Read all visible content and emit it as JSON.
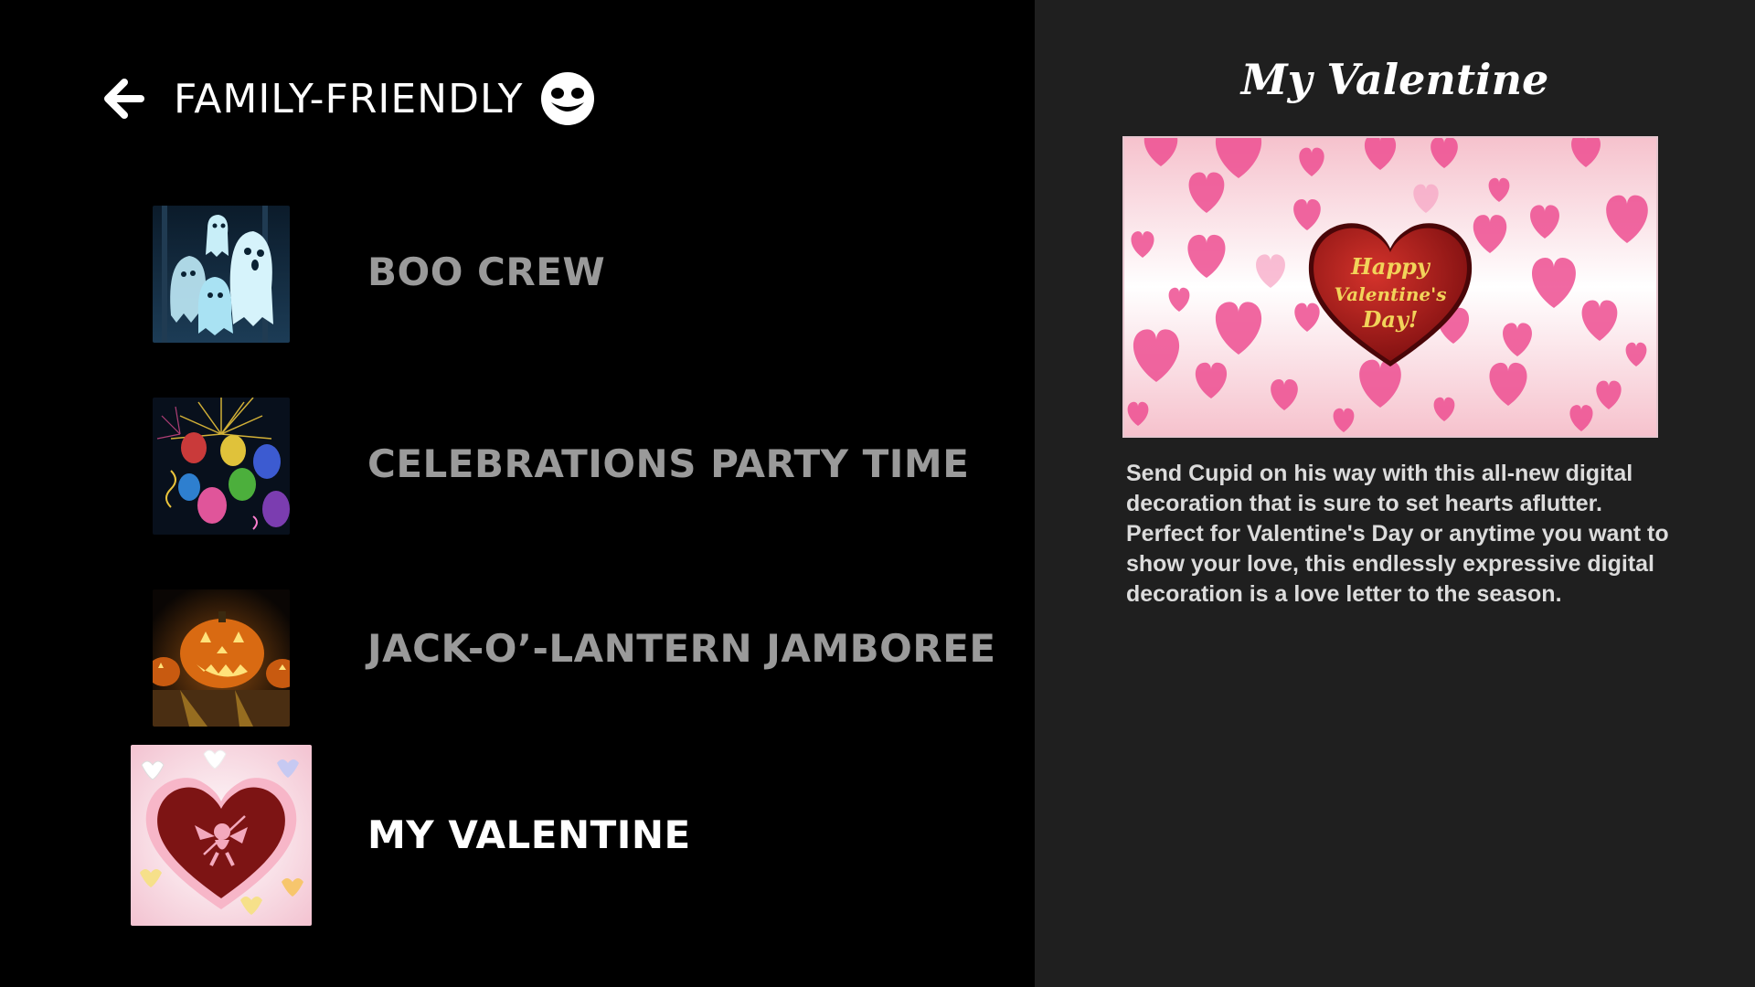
{
  "header": {
    "title": "FAMILY-FRIENDLY",
    "back_icon": "arrow-left-icon",
    "category_icon": "smiley-face-icon"
  },
  "list": {
    "items": [
      {
        "label": "BOO CREW",
        "thumbnail": "ghosts"
      },
      {
        "label": "CELEBRATIONS PARTY TIME",
        "thumbnail": "balloons-fireworks"
      },
      {
        "label": "JACK-O’-LANTERN JAMBOREE",
        "thumbnail": "jack-o-lanterns"
      },
      {
        "label": "MY VALENTINE",
        "thumbnail": "valentine-heart-cupid",
        "selected": true
      }
    ]
  },
  "detail": {
    "title": "My Valentine",
    "hero_text": [
      "Happy",
      "Valentine's",
      "Day!"
    ],
    "description": "Send Cupid on his way with this all-new digital decoration that is sure to set hearts aflutter. Perfect for Valentine's Day or anytime you want to show your love, this endlessly expressive digital decoration is a love letter to the season."
  },
  "colors": {
    "left_background": "#000000",
    "right_background": "#1f1f1f",
    "item_text": "#9a9a9a",
    "selected_text": "#ffffff"
  }
}
